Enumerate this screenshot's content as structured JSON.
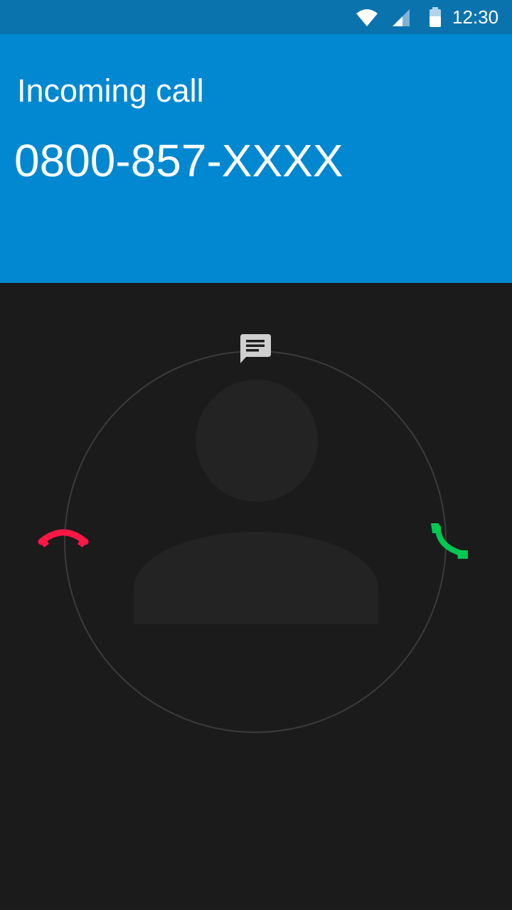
{
  "status_bar": {
    "time": "12:30",
    "icons": [
      "wifi-icon",
      "signal-icon",
      "battery-icon"
    ]
  },
  "header": {
    "call_state": "Incoming call",
    "caller_number": "0800-857-XXXX"
  },
  "glowpad": {
    "targets": [
      "message-icon",
      "decline-call-icon",
      "answer-call-icon"
    ]
  },
  "colors": {
    "status_bar_bg": "#0a73ad",
    "header_bg": "#0288d1",
    "screen_bg": "#1b1b1b",
    "decline": "#ff1744",
    "answer": "#00c853",
    "message": "#cfcfcf"
  }
}
